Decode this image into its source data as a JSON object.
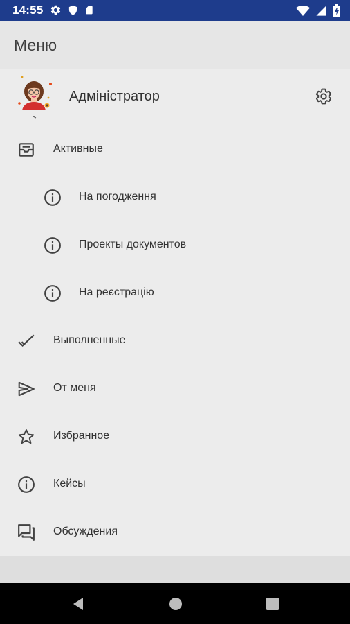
{
  "status_bar": {
    "time": "14:55",
    "left_icons": [
      "gear-icon",
      "shield-icon",
      "sd-card-icon"
    ],
    "right_icons": [
      "wifi-icon",
      "signal-icon",
      "battery-icon"
    ]
  },
  "app_bar": {
    "title": "Меню"
  },
  "profile": {
    "name": "Адміністратор"
  },
  "menu": {
    "items": [
      {
        "label": "Активные",
        "icon": "inbox-tray-icon"
      },
      {
        "label": "На погодження",
        "icon": "info-icon"
      },
      {
        "label": "Проекты документов",
        "icon": "info-icon"
      },
      {
        "label": "На реєстрацію",
        "icon": "info-icon"
      },
      {
        "label": "Выполненные",
        "icon": "checkmark-icon"
      },
      {
        "label": "От меня",
        "icon": "send-icon"
      },
      {
        "label": "Избранное",
        "icon": "star-icon"
      },
      {
        "label": "Кейсы",
        "icon": "info-icon"
      },
      {
        "label": "Обсуждения",
        "icon": "forum-icon"
      }
    ]
  },
  "colors": {
    "status_bar": "#1e3c8c",
    "app_bar": "#e6e6e6",
    "drawer_background": "#ececec",
    "icon": "#424242",
    "navigation_bar": "#000000"
  }
}
